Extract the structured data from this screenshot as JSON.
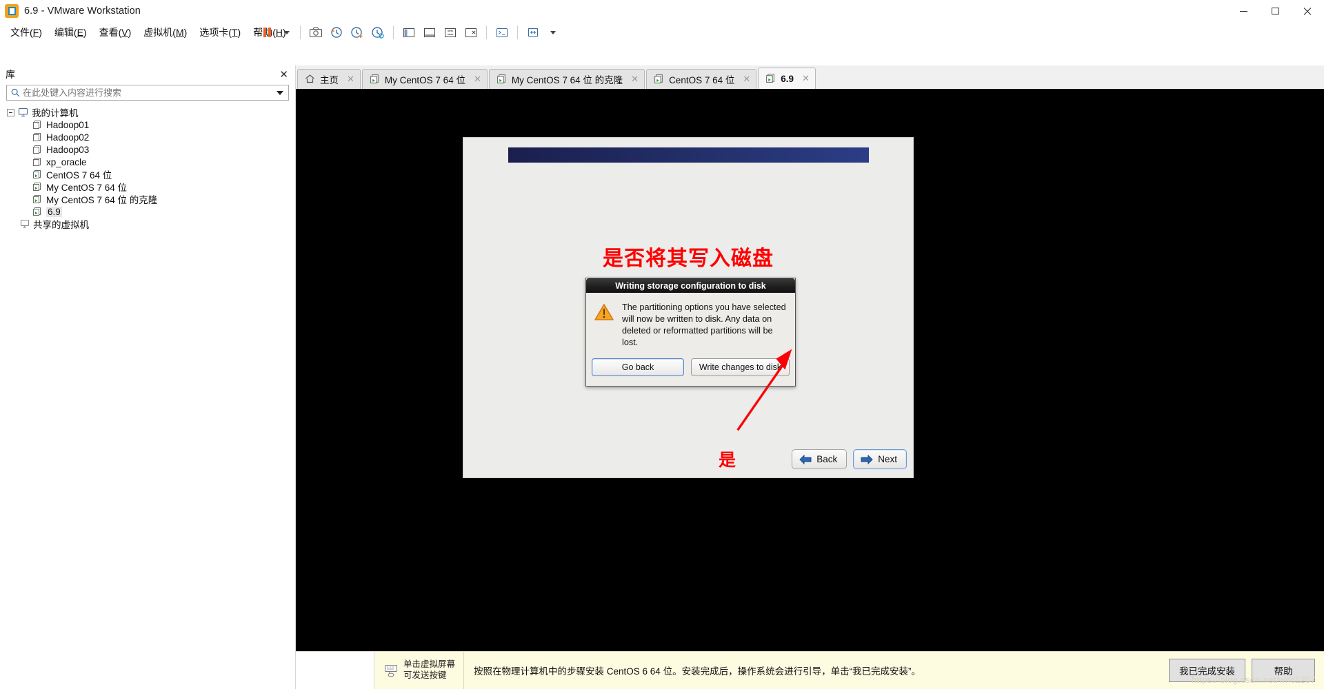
{
  "window": {
    "title": "6.9 - VMware Workstation",
    "app_icon": "vmware-logo-icon",
    "minimize": "–",
    "maximize": "❐",
    "close": "✕"
  },
  "menubar": {
    "items": [
      {
        "name": "file",
        "text": "文件(F)",
        "pre": "文件(",
        "key": "F",
        "post": ")"
      },
      {
        "name": "edit",
        "text": "编辑(E)",
        "pre": "编辑(",
        "key": "E",
        "post": ")"
      },
      {
        "name": "view",
        "text": "查看(V)",
        "pre": "查看(",
        "key": "V",
        "post": ")"
      },
      {
        "name": "vm",
        "text": "虚拟机(M)",
        "pre": "虚拟机(",
        "key": "M",
        "post": ")"
      },
      {
        "name": "tabs",
        "text": "选项卡(T)",
        "pre": "选项卡(",
        "key": "T",
        "post": ")"
      },
      {
        "name": "help",
        "text": "帮助(H)",
        "pre": "帮助(",
        "key": "H",
        "post": ")"
      }
    ]
  },
  "toolbar": {
    "items": [
      {
        "name": "suspend-button",
        "icon": "pause-icon"
      },
      {
        "name": "suspend-dropdown",
        "icon": "chevron-down-icon"
      },
      {
        "name": "snapshot-manager-button",
        "icon": "camera-icon"
      },
      {
        "name": "revert-snapshot-button",
        "icon": "clock-revert-icon"
      },
      {
        "name": "take-snapshot-button",
        "icon": "clock-add-icon"
      },
      {
        "name": "manage-snapshots-button",
        "icon": "clock-manage-icon"
      },
      {
        "name": "show-library-button",
        "icon": "panel-left-icon"
      },
      {
        "name": "show-thumbnail-bar-button",
        "icon": "panel-bottom-icon"
      },
      {
        "name": "full-screen-button",
        "icon": "expand-icon"
      },
      {
        "name": "unity-button",
        "icon": "unity-icon"
      },
      {
        "name": "console-button",
        "icon": "console-icon"
      },
      {
        "name": "stretch-button",
        "icon": "stretch-icon"
      },
      {
        "name": "stretch-dropdown",
        "icon": "chevron-down-icon"
      }
    ]
  },
  "library": {
    "title": "库",
    "close_icon": "close-icon",
    "search": {
      "placeholder": "在此处键入内容进行搜索",
      "value": "",
      "icon": "search-icon",
      "dropdown_icon": "chevron-down-icon"
    },
    "tree": [
      {
        "name": "my-computer",
        "label": "我的计算机",
        "level": 0,
        "icon": "computer-icon",
        "expanded": true,
        "selected": false
      },
      {
        "name": "vm-hadoop01",
        "label": "Hadoop01",
        "level": 1,
        "icon": "vm-off-icon",
        "selected": false
      },
      {
        "name": "vm-hadoop02",
        "label": "Hadoop02",
        "level": 1,
        "icon": "vm-off-icon",
        "selected": false
      },
      {
        "name": "vm-hadoop03",
        "label": "Hadoop03",
        "level": 1,
        "icon": "vm-off-icon",
        "selected": false
      },
      {
        "name": "vm-xp-oracle",
        "label": "xp_oracle",
        "level": 1,
        "icon": "vm-off-icon",
        "selected": false
      },
      {
        "name": "vm-centos7",
        "label": "CentOS 7 64 位",
        "level": 1,
        "icon": "vm-on-icon",
        "selected": false
      },
      {
        "name": "vm-my-centos7",
        "label": "My CentOS 7 64 位",
        "level": 1,
        "icon": "vm-on-icon",
        "selected": false
      },
      {
        "name": "vm-my-centos7-clone",
        "label": "My CentOS 7 64 位 的克隆",
        "level": 1,
        "icon": "vm-on-icon",
        "selected": false
      },
      {
        "name": "vm-6-9",
        "label": "6.9",
        "level": 1,
        "icon": "vm-on-icon",
        "selected": true
      },
      {
        "name": "shared-vms",
        "label": "共享的虚拟机",
        "level": 0,
        "icon": "shared-vm-icon",
        "expanded": false,
        "selected": false
      }
    ]
  },
  "tabs": [
    {
      "name": "tab-home",
      "label": "主页",
      "icon": "home-icon",
      "active": false,
      "close_icon": "close-icon"
    },
    {
      "name": "tab-my-centos7",
      "label": "My CentOS 7 64 位",
      "icon": "vm-on-icon",
      "active": false,
      "close_icon": "close-icon"
    },
    {
      "name": "tab-my-centos7-clone",
      "label": "My CentOS 7 64 位 的克隆",
      "icon": "vm-on-icon",
      "active": false,
      "close_icon": "close-icon"
    },
    {
      "name": "tab-centos7",
      "label": "CentOS 7 64 位",
      "icon": "vm-on-icon",
      "active": false,
      "close_icon": "close-icon"
    },
    {
      "name": "tab-6-9",
      "label": "6.9",
      "icon": "vm-on-icon",
      "active": true,
      "close_icon": "close-icon"
    }
  ],
  "installer": {
    "annotation_question": "是否将其写入磁盘",
    "annotation_yes": "是",
    "dialog": {
      "title": "Writing storage configuration to disk",
      "warning_icon": "warning-triangle-icon",
      "message": "The partitioning options you have selected will now be written to disk.  Any data on deleted or reformatted partitions will be lost.",
      "buttons": [
        {
          "name": "go-back-button",
          "label": "Go back",
          "focused": true
        },
        {
          "name": "write-changes-to-disk-button",
          "label": "Write changes to disk",
          "focused": false
        }
      ]
    },
    "nav": [
      {
        "name": "back-button",
        "label": "Back",
        "icon": "arrow-left-icon",
        "primary": false
      },
      {
        "name": "next-button",
        "label": "Next",
        "icon": "arrow-right-icon",
        "primary": true
      }
    ]
  },
  "statusbar": {
    "hint_icon": "keyboard-icon",
    "hint_line1": "单击虚拟屏幕",
    "hint_line2": "可发送按键",
    "message": "按照在物理计算机中的步骤安装 CentOS 6 64 位。安装完成后，操作系统会进行引导，单击“我已完成安装”。",
    "buttons": [
      {
        "name": "installation-complete-button",
        "label": "我已完成安装"
      },
      {
        "name": "help-button",
        "label": "帮助"
      }
    ],
    "watermark": "https://blog.csdn.net/wxc1207"
  }
}
